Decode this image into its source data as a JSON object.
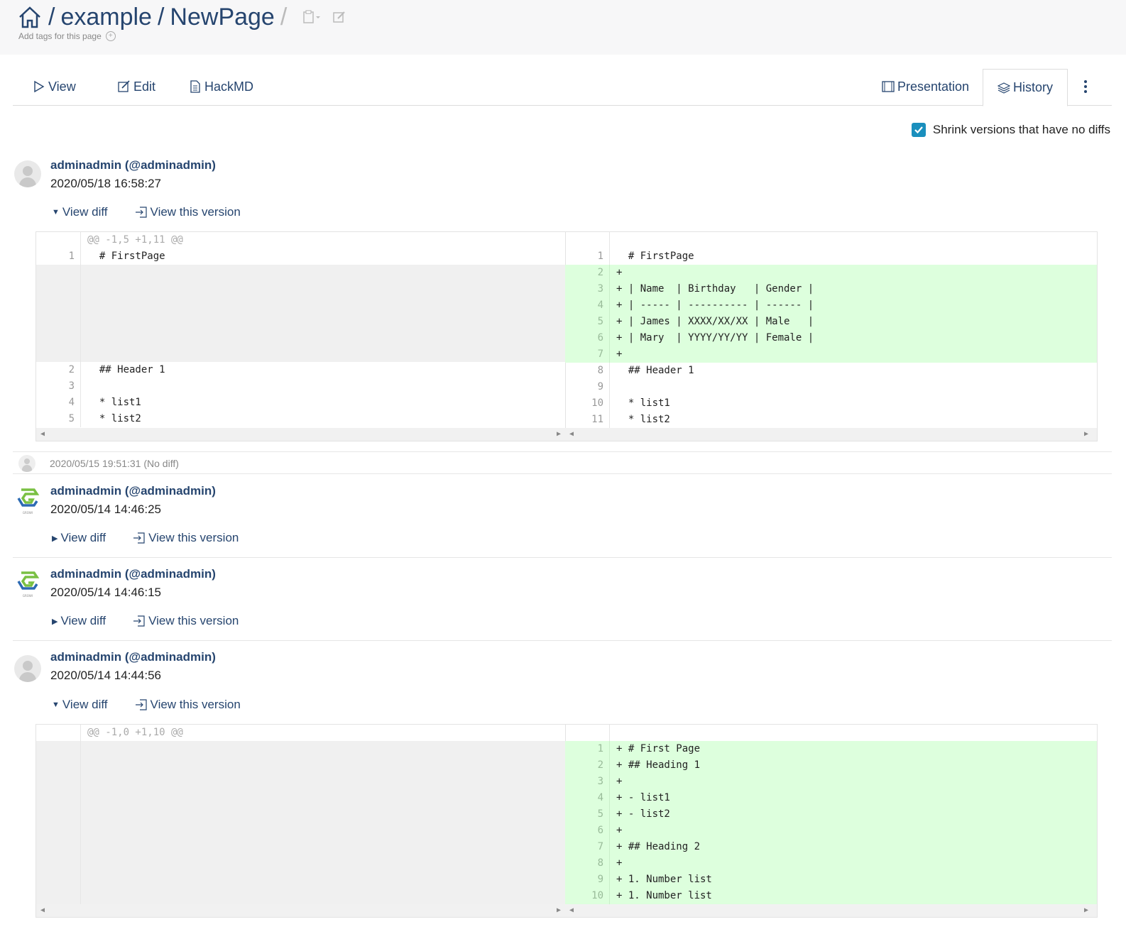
{
  "breadcrumb": {
    "part1": "example",
    "part2": "NewPage"
  },
  "tags_label": "Add tags for this page",
  "tabs": {
    "view": "View",
    "edit": "Edit",
    "hackmd": "HackMD",
    "presentation": "Presentation",
    "history": "History"
  },
  "shrink_label": "Shrink versions that have no diffs",
  "colors": {
    "link": "#26456f",
    "added_bg": "#ddffdd",
    "checkbox": "#1a8fbd"
  },
  "revisions": [
    {
      "author": "adminadmin (@adminadmin)",
      "date": "2020/05/18 16:58:27",
      "view_diff": "View diff",
      "view_version": "View this version",
      "avatar": "default-avatar"
    },
    {
      "date_nodiff": "2020/05/15 19:51:31 (No diff)",
      "avatar": "default-avatar"
    },
    {
      "author": "adminadmin (@adminadmin)",
      "date": "2020/05/14 14:46:25",
      "view_diff": "View diff",
      "view_version": "View this version",
      "avatar": "growi-logo"
    },
    {
      "author": "adminadmin (@adminadmin)",
      "date": "2020/05/14 14:46:15",
      "view_diff": "View diff",
      "view_version": "View this version",
      "avatar": "growi-logo"
    },
    {
      "author": "adminadmin (@adminadmin)",
      "date": "2020/05/14 14:44:56",
      "view_diff": "View diff",
      "view_version": "View this version",
      "avatar": "default-avatar"
    }
  ],
  "diff1": {
    "hunk": "@@ -1,5 +1,11 @@",
    "left": [
      {
        "n": "1",
        "t": "  # FirstPage"
      },
      {
        "n": "2",
        "t": "  ## Header 1"
      },
      {
        "n": "3",
        "t": ""
      },
      {
        "n": "4",
        "t": "  * list1"
      },
      {
        "n": "5",
        "t": "  * list2"
      }
    ],
    "right": [
      {
        "n": "1",
        "t": "  # FirstPage"
      },
      {
        "n": "2",
        "t": "+"
      },
      {
        "n": "3",
        "t": "+ | Name  | Birthday   | Gender |"
      },
      {
        "n": "4",
        "t": "+ | ----- | ---------- | ------ |"
      },
      {
        "n": "5",
        "t": "+ | James | XXXX/XX/XX | Male   |"
      },
      {
        "n": "6",
        "t": "+ | Mary  | YYYY/YY/YY | Female |"
      },
      {
        "n": "7",
        "t": "+"
      },
      {
        "n": "8",
        "t": "  ## Header 1"
      },
      {
        "n": "9",
        "t": ""
      },
      {
        "n": "10",
        "t": "  * list1"
      },
      {
        "n": "11",
        "t": "  * list2"
      }
    ]
  },
  "diff2": {
    "hunk": "@@ -1,0 +1,10 @@",
    "right": [
      {
        "n": "1",
        "t": "+ # First Page"
      },
      {
        "n": "2",
        "t": "+ ## Heading 1"
      },
      {
        "n": "3",
        "t": "+"
      },
      {
        "n": "4",
        "t": "+ - list1"
      },
      {
        "n": "5",
        "t": "+ - list2"
      },
      {
        "n": "6",
        "t": "+"
      },
      {
        "n": "7",
        "t": "+ ## Heading 2"
      },
      {
        "n": "8",
        "t": "+"
      },
      {
        "n": "9",
        "t": "+ 1. Number list"
      },
      {
        "n": "10",
        "t": "+ 1. Number list"
      }
    ]
  }
}
